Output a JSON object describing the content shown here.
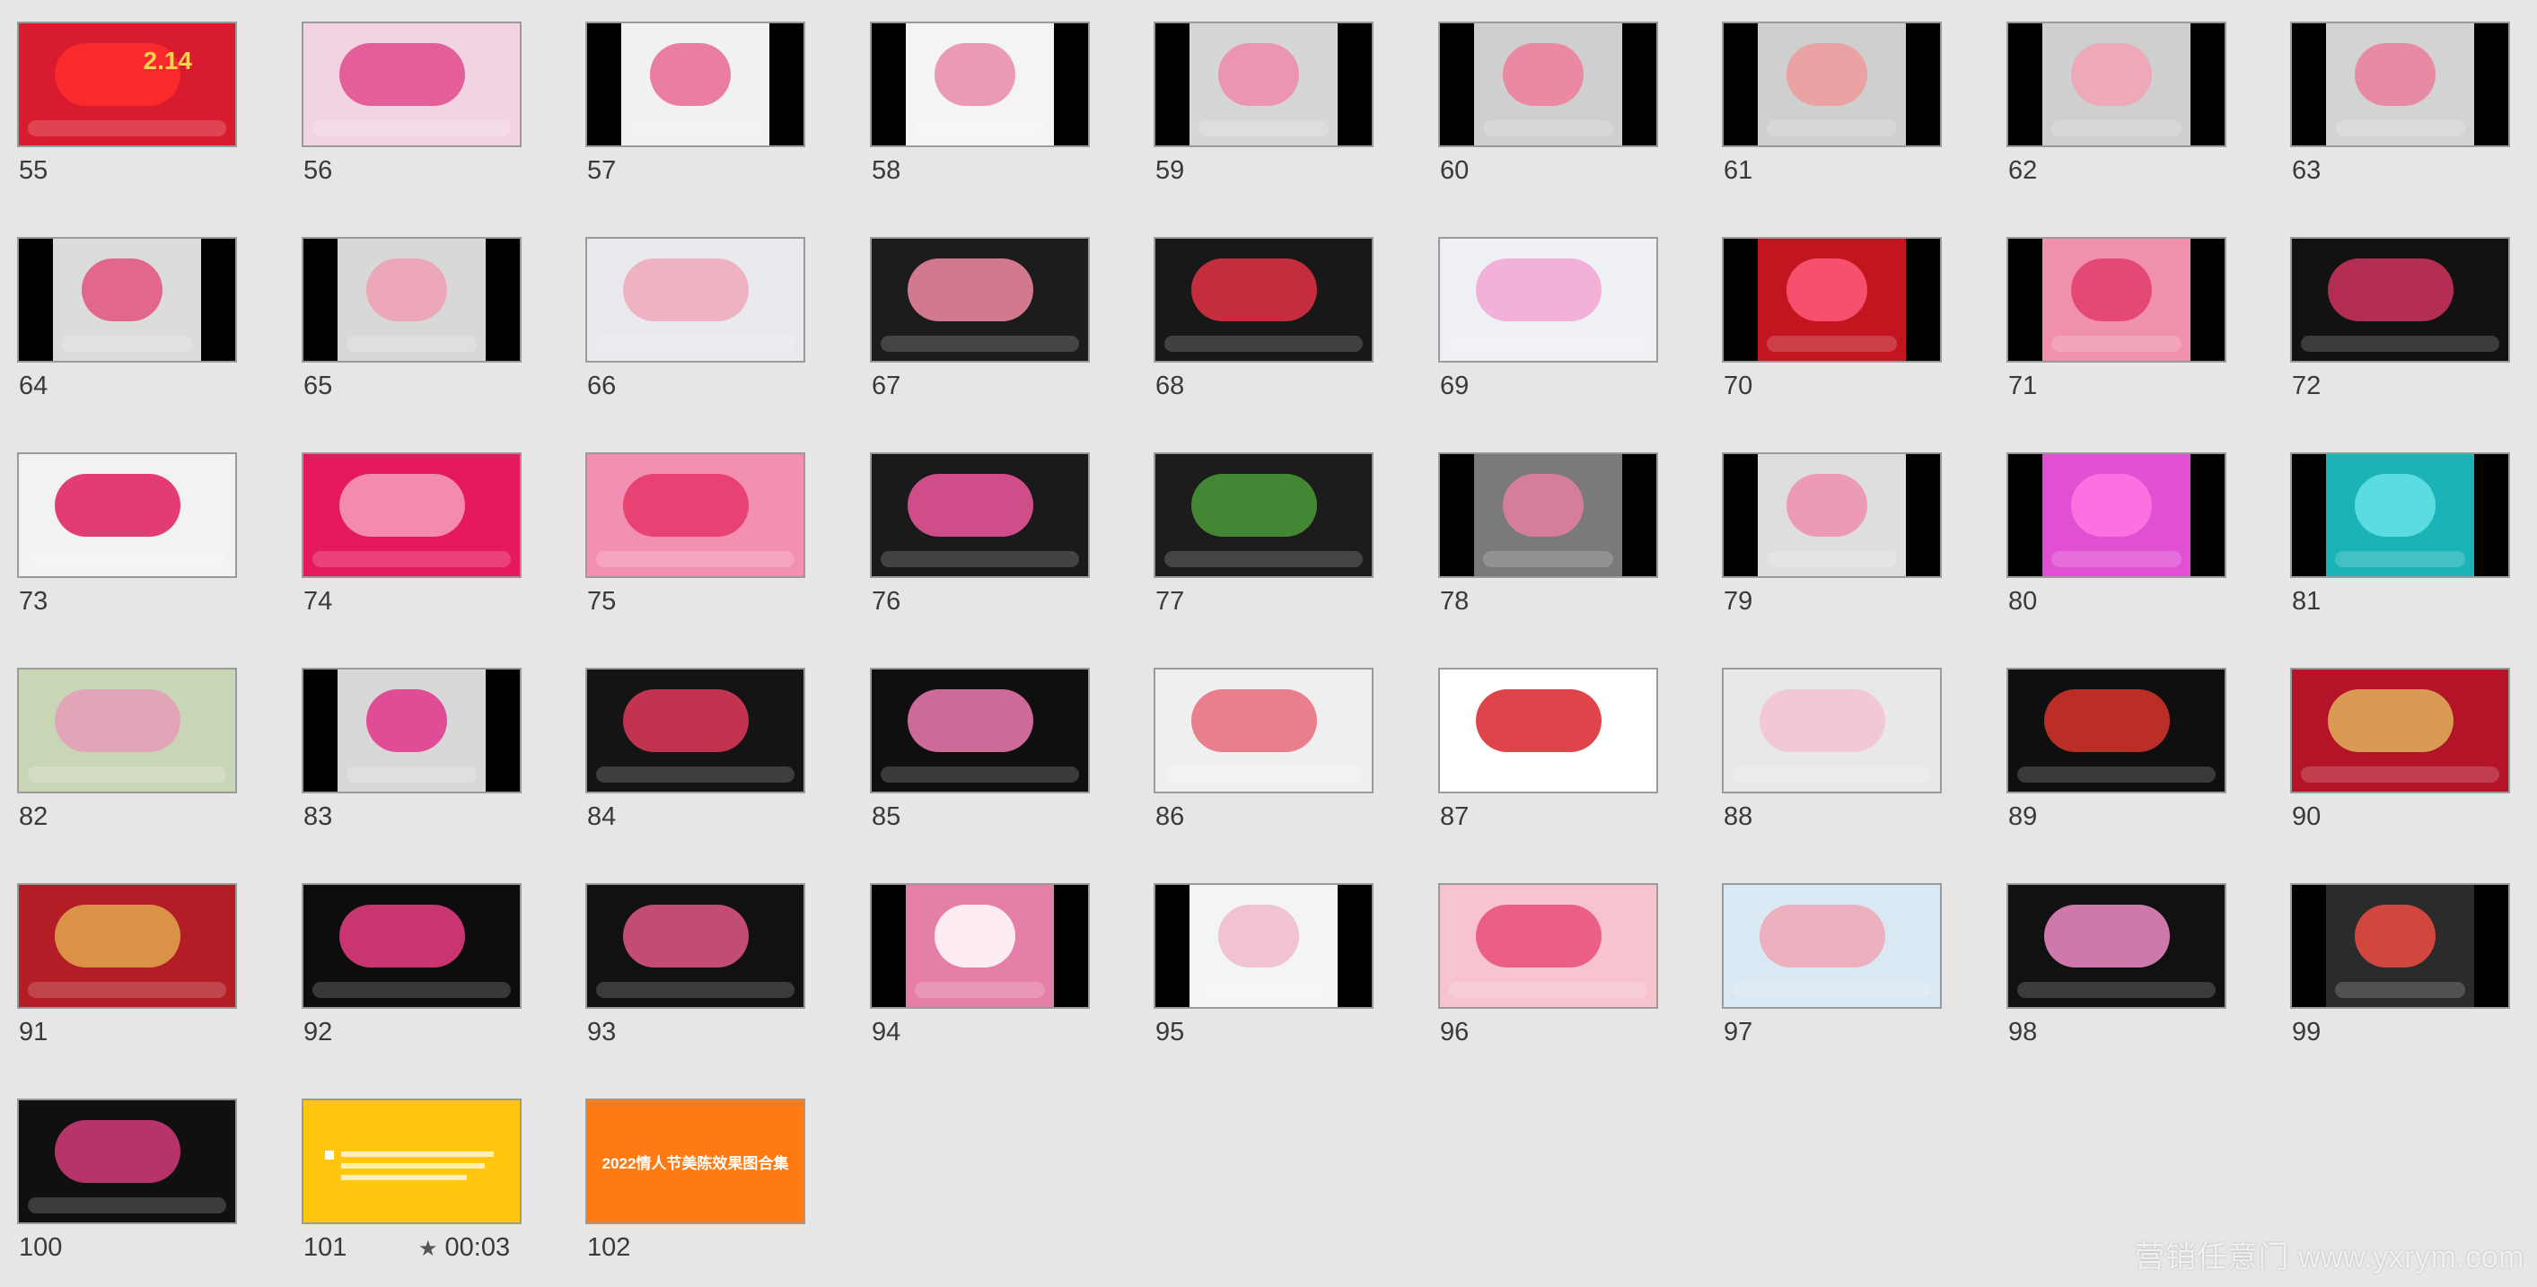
{
  "slides": [
    {
      "number": "55",
      "thumb": {
        "bg": "#1b0c10",
        "inner": "#d81b2e",
        "bars": false,
        "accent": "#ff2b2b",
        "caption": "2.14"
      }
    },
    {
      "number": "56",
      "thumb": {
        "bg": "#111111",
        "inner": "#f2d3e2",
        "bars": false,
        "accent": "#e24a8c"
      }
    },
    {
      "number": "57",
      "thumb": {
        "bg": "#000000",
        "inner": "#f1f1f1",
        "bars": true,
        "accent": "#e86a93"
      }
    },
    {
      "number": "58",
      "thumb": {
        "bg": "#000000",
        "inner": "#f4f4f4",
        "bars": true,
        "accent": "#e88aa9"
      }
    },
    {
      "number": "59",
      "thumb": {
        "bg": "#000000",
        "inner": "#d6d6d6",
        "bars": true,
        "accent": "#f08aac"
      }
    },
    {
      "number": "60",
      "thumb": {
        "bg": "#000000",
        "inner": "#cfcfcf",
        "bars": true,
        "accent": "#f07c9a"
      }
    },
    {
      "number": "61",
      "thumb": {
        "bg": "#000000",
        "inner": "#cfcfcf",
        "bars": true,
        "accent": "#f09a9a"
      }
    },
    {
      "number": "62",
      "thumb": {
        "bg": "#000000",
        "inner": "#cfcfcf",
        "bars": true,
        "accent": "#f2a2b4"
      }
    },
    {
      "number": "63",
      "thumb": {
        "bg": "#000000",
        "inner": "#d3d3d3",
        "bars": true,
        "accent": "#ea7e9b"
      }
    },
    {
      "number": "64",
      "thumb": {
        "bg": "#000000",
        "inner": "#dcdcdc",
        "bars": true,
        "accent": "#e2527f"
      }
    },
    {
      "number": "65",
      "thumb": {
        "bg": "#000000",
        "inner": "#d8d8d8",
        "bars": true,
        "accent": "#f0a0b3"
      }
    },
    {
      "number": "66",
      "thumb": {
        "bg": "#cfd3dc",
        "inner": "#e9e9ee",
        "bars": false,
        "accent": "#f0a8ba"
      }
    },
    {
      "number": "67",
      "thumb": {
        "bg": "#111111",
        "inner": "#1c1c1c",
        "bars": false,
        "accent": "#f28aa3"
      }
    },
    {
      "number": "68",
      "thumb": {
        "bg": "#0a0a0a",
        "inner": "#181818",
        "bars": false,
        "accent": "#e43045"
      }
    },
    {
      "number": "69",
      "thumb": {
        "bg": "#e9ebef",
        "inner": "#eef0f3",
        "bars": false,
        "accent": "#f3a6d5"
      }
    },
    {
      "number": "70",
      "thumb": {
        "bg": "#000000",
        "inner": "#c2151f",
        "bars": true,
        "accent": "#ff5a7a"
      }
    },
    {
      "number": "71",
      "thumb": {
        "bg": "#000000",
        "inner": "#f090ac",
        "bars": true,
        "accent": "#e23d6b"
      }
    },
    {
      "number": "72",
      "thumb": {
        "bg": "#050505",
        "inner": "#121212",
        "bars": false,
        "accent": "#d1335f"
      }
    },
    {
      "number": "73",
      "thumb": {
        "bg": "#d1185d",
        "inner": "#f2f2f2",
        "bars": false,
        "accent": "#e01c5c"
      }
    },
    {
      "number": "74",
      "thumb": {
        "bg": "#0a0a0a",
        "inner": "#e6185e",
        "bars": false,
        "accent": "#f5a0c0"
      }
    },
    {
      "number": "75",
      "thumb": {
        "bg": "#0c0c0c",
        "inner": "#f38fb0",
        "bars": false,
        "accent": "#e5356b"
      }
    },
    {
      "number": "76",
      "thumb": {
        "bg": "#0b0b0b",
        "inner": "#1a1a1a",
        "bars": false,
        "accent": "#f0579c"
      }
    },
    {
      "number": "77",
      "thumb": {
        "bg": "#0b0b0b",
        "inner": "#1c1c1c",
        "bars": false,
        "accent": "#4a9a3a"
      }
    },
    {
      "number": "78",
      "thumb": {
        "bg": "#000000",
        "inner": "#7a7a7a",
        "bars": true,
        "accent": "#e57fa0"
      }
    },
    {
      "number": "79",
      "thumb": {
        "bg": "#000000",
        "inner": "#dedede",
        "bars": true,
        "accent": "#f08eb0"
      }
    },
    {
      "number": "80",
      "thumb": {
        "bg": "#000000",
        "inner": "#e14fd3",
        "bars": true,
        "accent": "#ff77e4"
      }
    },
    {
      "number": "81",
      "thumb": {
        "bg": "#000000",
        "inner": "#1ab3b8",
        "bars": true,
        "accent": "#66e3e7"
      }
    },
    {
      "number": "82",
      "thumb": {
        "bg": "#d9c6a8",
        "inner": "#c9d6b6",
        "bars": false,
        "accent": "#e69bb7"
      }
    },
    {
      "number": "83",
      "thumb": {
        "bg": "#000000",
        "inner": "#d8d8d8",
        "bars": true,
        "accent": "#e2348a"
      }
    },
    {
      "number": "84",
      "thumb": {
        "bg": "#0b0b0b",
        "inner": "#141414",
        "bars": false,
        "accent": "#e0385a"
      }
    },
    {
      "number": "85",
      "thumb": {
        "bg": "#050505",
        "inner": "#0f0f0f",
        "bars": false,
        "accent": "#f07ab2"
      }
    },
    {
      "number": "86",
      "thumb": {
        "bg": "#e7e7e7",
        "inner": "#efefef",
        "bars": false,
        "accent": "#e86b7a"
      }
    },
    {
      "number": "87",
      "thumb": {
        "bg": "#f2f2f2",
        "inner": "#ffffff",
        "bars": false,
        "accent": "#d8232a"
      }
    },
    {
      "number": "88",
      "thumb": {
        "bg": "#dcdcdc",
        "inner": "#e8e8e8",
        "bars": false,
        "accent": "#f3c1d3"
      }
    },
    {
      "number": "89",
      "thumb": {
        "bg": "#040404",
        "inner": "#0f0f0f",
        "bars": false,
        "accent": "#d9342c"
      }
    },
    {
      "number": "90",
      "thumb": {
        "bg": "#ffffff",
        "inner": "#b31428",
        "bars": false,
        "accent": "#e0b25c"
      }
    },
    {
      "number": "91",
      "thumb": {
        "bg": "#ffffff",
        "inner": "#b41d26",
        "bars": false,
        "accent": "#e1a84c"
      }
    },
    {
      "number": "92",
      "thumb": {
        "bg": "#000000",
        "inner": "#0d0d0d",
        "bars": false,
        "accent": "#eb3d83"
      }
    },
    {
      "number": "93",
      "thumb": {
        "bg": "#000000",
        "inner": "#111111",
        "bars": false,
        "accent": "#e25788"
      }
    },
    {
      "number": "94",
      "thumb": {
        "bg": "#000000",
        "inner": "#e67fa8",
        "bars": true,
        "accent": "#ffffff"
      }
    },
    {
      "number": "95",
      "thumb": {
        "bg": "#000000",
        "inner": "#f3f4f6",
        "bars": true,
        "accent": "#f0b8c8"
      }
    },
    {
      "number": "96",
      "thumb": {
        "bg": "#8fd3e8",
        "inner": "#f6c3cf",
        "bars": false,
        "accent": "#e94d7a"
      }
    },
    {
      "number": "97",
      "thumb": {
        "bg": "#cde1ee",
        "inner": "#d9e8f2",
        "bars": false,
        "accent": "#f0a6b6"
      }
    },
    {
      "number": "98",
      "thumb": {
        "bg": "#050505",
        "inner": "#111111",
        "bars": false,
        "accent": "#f08bc7"
      }
    },
    {
      "number": "99",
      "thumb": {
        "bg": "#000000",
        "inner": "#2b2b2b",
        "bars": true,
        "accent": "#ef4c41"
      }
    },
    {
      "number": "100",
      "thumb": {
        "bg": "#050505",
        "inner": "#101010",
        "bars": false,
        "accent": "#d33b7a"
      }
    },
    {
      "number": "101",
      "thumb": {
        "bg": "#ffc60d",
        "inner": "#ffc60d",
        "bars": false,
        "accent": "#ffffff",
        "lines": true
      },
      "meta": {
        "star": "★",
        "time": "00:03"
      }
    },
    {
      "number": "102",
      "thumb": {
        "bg": "#ff7a12",
        "inner": "#ff7a12",
        "bars": false,
        "accent": "#ffffff",
        "title": "2022情人节美陈效果图合集"
      }
    }
  ],
  "watermark": "营销任意门 www.yxrym.com"
}
